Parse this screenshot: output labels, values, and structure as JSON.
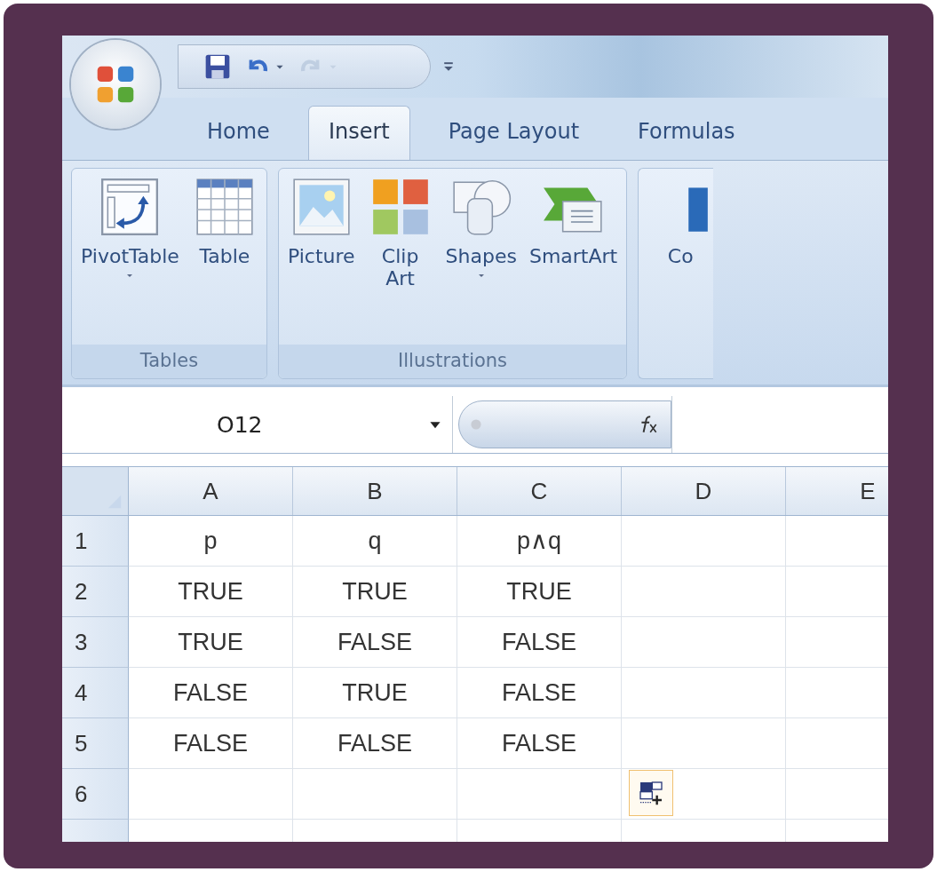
{
  "quick_access": [
    {
      "kind": "save",
      "disabled": false,
      "dropdown": false
    },
    {
      "kind": "undo",
      "disabled": false,
      "dropdown": true
    },
    {
      "kind": "redo",
      "disabled": true,
      "dropdown": true
    }
  ],
  "tabs": [
    {
      "label": "Home",
      "selected": false
    },
    {
      "label": "Insert",
      "selected": true
    },
    {
      "label": "Page Layout",
      "selected": false
    },
    {
      "label": "Formulas",
      "selected": false
    }
  ],
  "ribbon_groups": [
    {
      "label": "Tables",
      "buttons": [
        {
          "kind": "pivottable",
          "label": "PivotTable",
          "dropdown": true
        },
        {
          "kind": "table",
          "label": "Table",
          "dropdown": false
        }
      ]
    },
    {
      "label": "Illustrations",
      "buttons": [
        {
          "kind": "picture",
          "label": "Picture",
          "dropdown": false
        },
        {
          "kind": "clipart",
          "label": "Clip Art",
          "dropdown": false
        },
        {
          "kind": "shapes",
          "label": "Shapes",
          "dropdown": true
        },
        {
          "kind": "smartart",
          "label": "SmartArt",
          "dropdown": false
        }
      ]
    },
    {
      "buttons": [
        {
          "kind": "chart",
          "label": "Co",
          "dropdown": false
        }
      ]
    }
  ],
  "name_box": "O12",
  "grid": {
    "columns": [
      "A",
      "B",
      "C",
      "D",
      "E"
    ],
    "rows": [
      {
        "header": "1",
        "cells": [
          "p",
          "q",
          "p∧q"
        ]
      },
      {
        "header": "2",
        "cells": [
          "TRUE",
          "TRUE",
          "TRUE"
        ]
      },
      {
        "header": "3",
        "cells": [
          "TRUE",
          "FALSE",
          "FALSE"
        ]
      },
      {
        "header": "4",
        "cells": [
          "FALSE",
          "TRUE",
          "FALSE"
        ]
      },
      {
        "header": "5",
        "cells": [
          "FALSE",
          "FALSE",
          "FALSE"
        ]
      },
      {
        "header": "6"
      }
    ]
  }
}
